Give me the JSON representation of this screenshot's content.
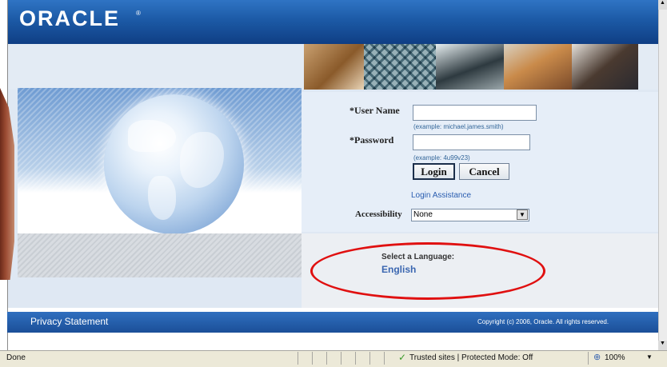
{
  "header": {
    "logo_text": "ORACLE",
    "logo_mark": "®"
  },
  "login_form": {
    "username_label": "*User Name",
    "username_value": "",
    "username_hint": "(example: michael.james.smith)",
    "password_label": "*Password",
    "password_value": "",
    "password_hint": "(example: 4u99v23)",
    "login_button": "Login",
    "cancel_button": "Cancel",
    "assistance_link": "Login Assistance",
    "accessibility_label": "Accessibility",
    "accessibility_value": "None"
  },
  "language": {
    "title": "Select a Language:",
    "english_link": "English"
  },
  "footer": {
    "privacy_link": "Privacy Statement",
    "copyright": "Copyright (c) 2006, Oracle. All rights reserved."
  },
  "status_bar": {
    "status": "Done",
    "zone": "Trusted sites | Protected Mode: Off",
    "zoom": "100%"
  },
  "colors": {
    "header_blue": "#1c5aa6",
    "annotation_red": "#e01010",
    "link_blue": "#2a5db0"
  }
}
